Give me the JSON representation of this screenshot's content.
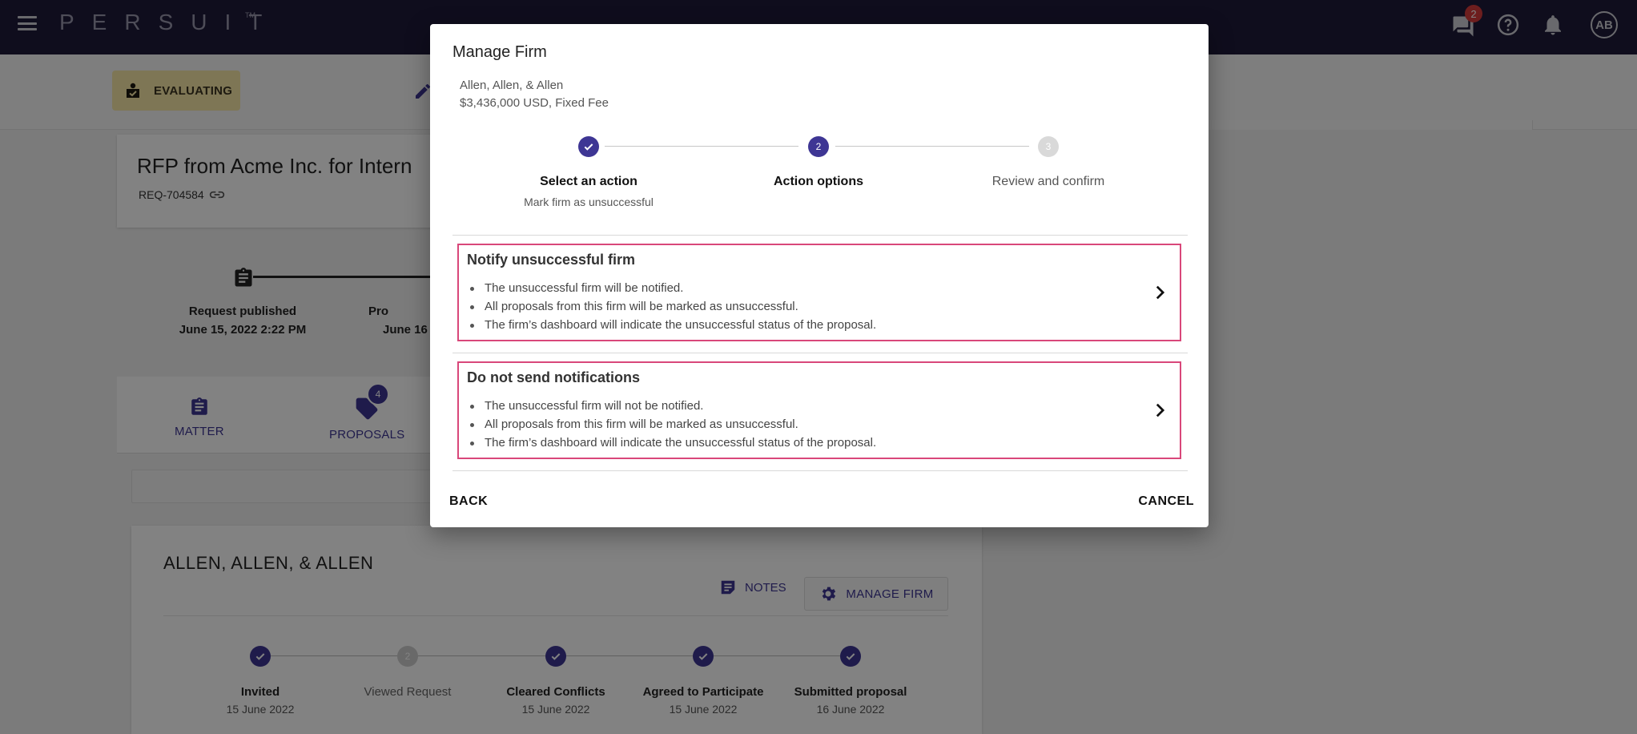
{
  "topbar": {
    "logo": "PERSUIT",
    "trademark": "TM",
    "messages_badge": "2",
    "avatar_initials": "AB"
  },
  "page": {
    "status_chip": "EVALUATING",
    "rfp_title": "RFP from Acme Inc. for Intern",
    "request_id": "REQ-704584",
    "timeline": [
      {
        "label": "Request published",
        "date": "June 15, 2022 2:22 PM"
      },
      {
        "label": "Pro",
        "date": "June 16"
      }
    ],
    "tabs": [
      {
        "label": "MATTER"
      },
      {
        "label": "PROPOSALS",
        "badge": "4"
      }
    ],
    "firm": {
      "name": "ALLEN, ALLEN, & ALLEN",
      "notes_label": "NOTES",
      "manage_label": "MANAGE FIRM",
      "steps": [
        {
          "label": "Invited",
          "date": "15 June 2022",
          "state": "done"
        },
        {
          "label": "Viewed Request",
          "date": "",
          "state": "pending",
          "number": "2"
        },
        {
          "label": "Cleared Conflicts",
          "date": "15 June 2022",
          "state": "done"
        },
        {
          "label": "Agreed to Participate",
          "date": "15 June 2022",
          "state": "done"
        },
        {
          "label": "Submitted proposal",
          "date": "16 June 2022",
          "state": "done"
        }
      ]
    }
  },
  "dialog": {
    "title": "Manage Firm",
    "firm_name": "Allen, Allen, & Allen",
    "fee": "$3,436,000 USD, Fixed Fee",
    "steps": [
      {
        "label": "Select an action",
        "sub": "Mark firm as unsuccessful",
        "state": "done"
      },
      {
        "label": "Action options",
        "sub": "",
        "state": "active",
        "number": "2"
      },
      {
        "label": "Review and confirm",
        "sub": "",
        "state": "pending",
        "number": "3"
      }
    ],
    "options": [
      {
        "title": "Notify unsuccessful firm",
        "bullets": [
          "The unsuccessful firm will be notified.",
          "All proposals from this firm will be marked as unsuccessful.",
          "The firm’s dashboard will indicate the unsuccessful status of the proposal."
        ]
      },
      {
        "title": "Do not send notifications",
        "bullets": [
          "The unsuccessful firm will not be notified.",
          "All proposals from this firm will be marked as unsuccessful.",
          "The firm’s dashboard will indicate the unsuccessful status of the proposal."
        ]
      }
    ],
    "back_label": "BACK",
    "cancel_label": "CANCEL"
  },
  "colors": {
    "topbar": "#1e1a3a",
    "accent": "#3e3694",
    "option_border": "#d9477a",
    "badge_red": "#d63b3b",
    "evaluating_chip": "#f7e8a8"
  }
}
